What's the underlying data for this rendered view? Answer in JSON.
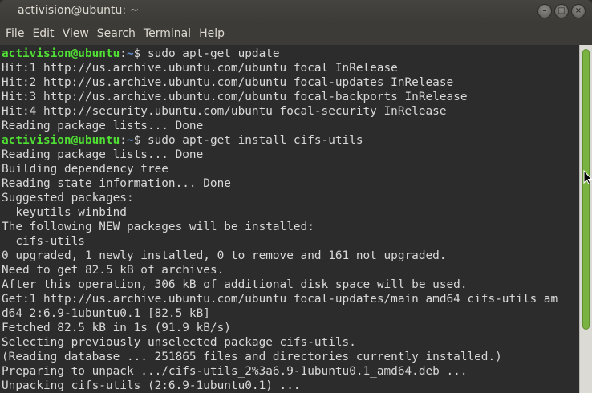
{
  "window": {
    "title": "activision@ubuntu: ~",
    "buttons": {
      "minimize": "–",
      "maximize": "□",
      "close": "×"
    }
  },
  "menubar": {
    "items": [
      "File",
      "Edit",
      "View",
      "Search",
      "Terminal",
      "Help"
    ]
  },
  "terminal": {
    "prompt_user": "activision@ubuntu",
    "prompt_sep": ":",
    "prompt_path": "~",
    "prompt_symbol": "$ ",
    "lines": [
      {
        "prompt": true,
        "command": "sudo apt-get update"
      },
      {
        "text": "Hit:1 http://us.archive.ubuntu.com/ubuntu focal InRelease"
      },
      {
        "text": "Hit:2 http://us.archive.ubuntu.com/ubuntu focal-updates InRelease"
      },
      {
        "text": "Hit:3 http://us.archive.ubuntu.com/ubuntu focal-backports InRelease"
      },
      {
        "text": "Hit:4 http://security.ubuntu.com/ubuntu focal-security InRelease"
      },
      {
        "text": "Reading package lists... Done"
      },
      {
        "prompt": true,
        "command": "sudo apt-get install cifs-utils"
      },
      {
        "text": "Reading package lists... Done"
      },
      {
        "text": "Building dependency tree"
      },
      {
        "text": "Reading state information... Done"
      },
      {
        "text": "Suggested packages:"
      },
      {
        "text": "  keyutils winbind"
      },
      {
        "text": "The following NEW packages will be installed:"
      },
      {
        "text": "  cifs-utils"
      },
      {
        "text": "0 upgraded, 1 newly installed, 0 to remove and 161 not upgraded."
      },
      {
        "text": "Need to get 82.5 kB of archives."
      },
      {
        "text": "After this operation, 306 kB of additional disk space will be used."
      },
      {
        "text": "Get:1 http://us.archive.ubuntu.com/ubuntu focal-updates/main amd64 cifs-utils am"
      },
      {
        "text": "d64 2:6.9-1ubuntu0.1 [82.5 kB]"
      },
      {
        "text": "Fetched 82.5 kB in 1s (91.9 kB/s)"
      },
      {
        "text": "Selecting previously unselected package cifs-utils."
      },
      {
        "text": "(Reading database ... 251865 files and directories currently installed.)"
      },
      {
        "text": "Preparing to unpack .../cifs-utils_2%3a6.9-1ubuntu0.1_amd64.deb ..."
      },
      {
        "text": "Unpacking cifs-utils (2:6.9-1ubuntu0.1) ..."
      }
    ]
  },
  "colors": {
    "prompt_user": "#4fe033",
    "prompt_path": "#5c8fd0",
    "background": "#2c2c2c",
    "scroll_thumb": "#7bb342"
  }
}
